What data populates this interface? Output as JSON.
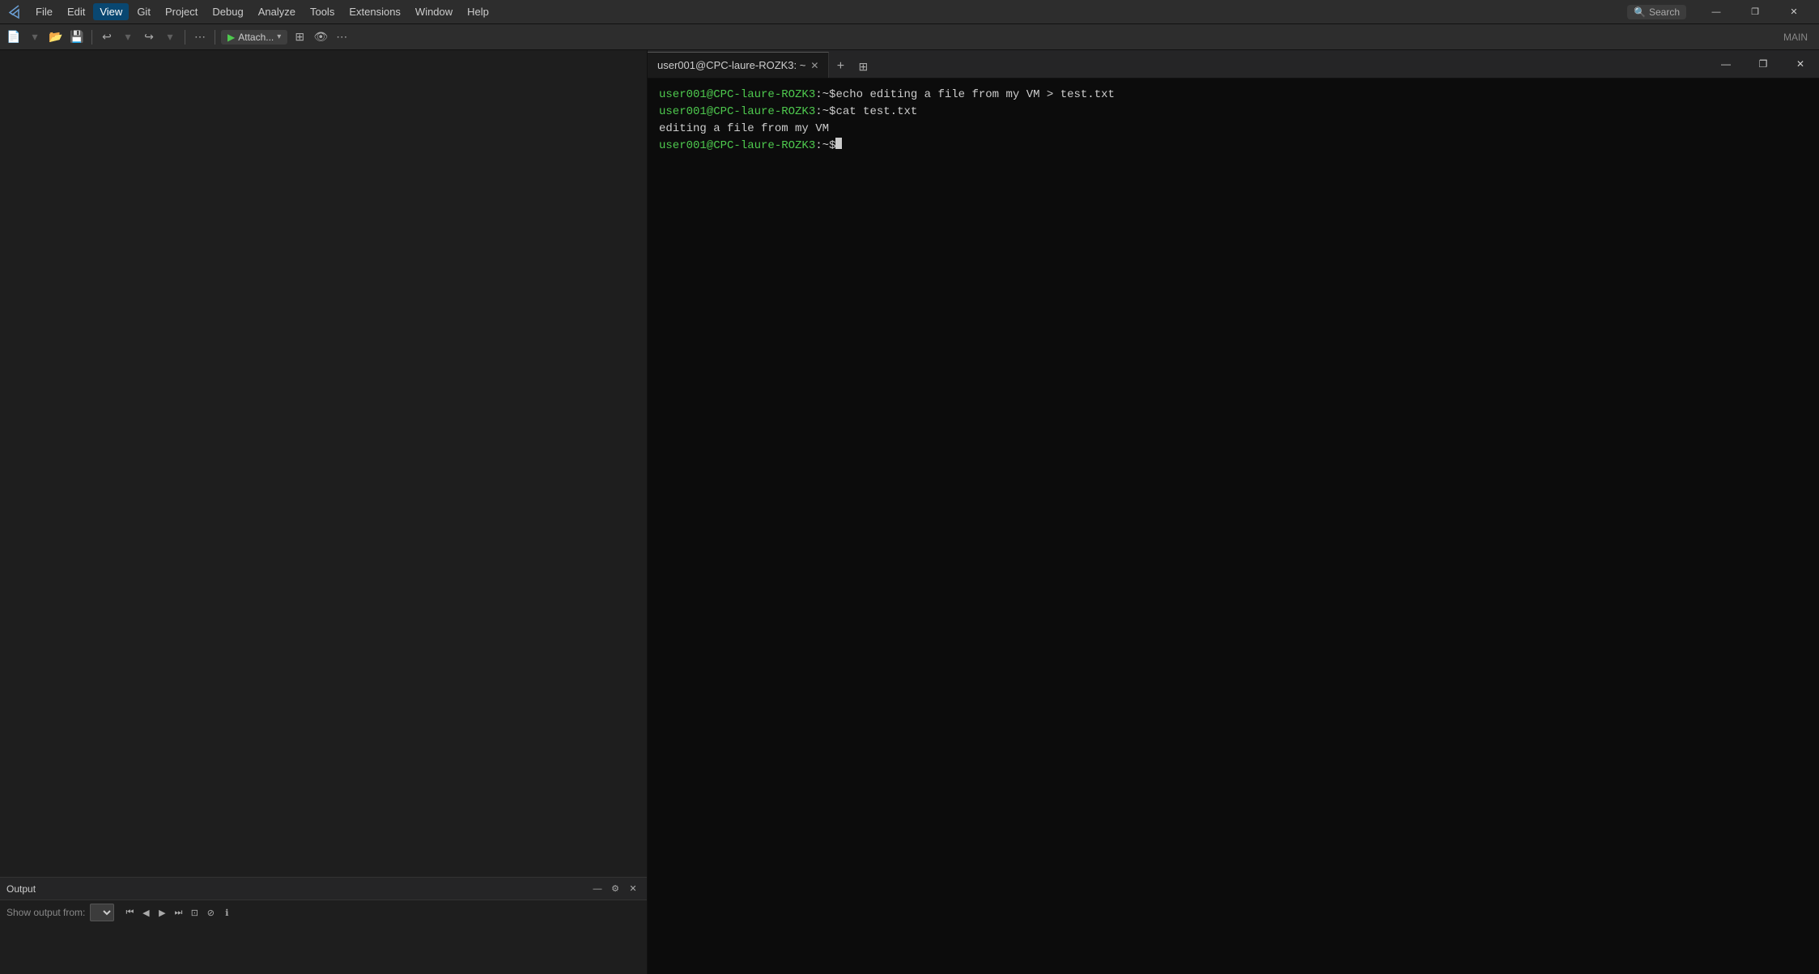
{
  "app": {
    "title": "Visual Studio",
    "logo_unicode": "⬡"
  },
  "menubar": {
    "items": [
      {
        "label": "File",
        "id": "file"
      },
      {
        "label": "Edit",
        "id": "edit"
      },
      {
        "label": "View",
        "id": "view",
        "active": true
      },
      {
        "label": "Git",
        "id": "git"
      },
      {
        "label": "Project",
        "id": "project"
      },
      {
        "label": "Debug",
        "id": "debug"
      },
      {
        "label": "Analyze",
        "id": "analyze"
      },
      {
        "label": "Tools",
        "id": "tools"
      },
      {
        "label": "Extensions",
        "id": "extensions"
      },
      {
        "label": "Window",
        "id": "window"
      },
      {
        "label": "Help",
        "id": "help"
      }
    ],
    "search": {
      "icon": "🔍",
      "label": "Search",
      "placeholder": "Search"
    }
  },
  "window_controls": {
    "minimize": "—",
    "restore": "❐",
    "close": "✕"
  },
  "toolbar": {
    "main_label": "MAIN",
    "attach_label": "Attach...",
    "buttons": [
      "new",
      "open",
      "save",
      "separator",
      "undo",
      "redo",
      "separator",
      "start",
      "attach",
      "more"
    ]
  },
  "editor": {
    "background": "#1e1e1e"
  },
  "output_panel": {
    "title": "Output",
    "show_from_label": "Show output from:",
    "show_from_value": "",
    "controls": {
      "minimize": "—",
      "settings": "⚙",
      "close": "✕"
    }
  },
  "terminal": {
    "tab_label": "user001@CPC-laure-ROZK3: ~",
    "tab_close": "✕",
    "new_tab": "+",
    "split_icon": "⊞",
    "lines": [
      {
        "prompt_green": "user001@CPC-laure-ROZK3",
        "prompt_white": ":~$",
        "command": " echo editing a file from my VM > test.txt"
      },
      {
        "prompt_green": "user001@CPC-laure-ROZK3",
        "prompt_white": ":~$",
        "command": " cat test.txt"
      },
      {
        "output": "editing a file from my VM"
      },
      {
        "prompt_green": "user001@CPC-laure-ROZK3",
        "prompt_white": ":~$",
        "cursor": true
      }
    ],
    "win_controls": {
      "minimize": "—",
      "restore": "❐",
      "close": "✕"
    }
  }
}
